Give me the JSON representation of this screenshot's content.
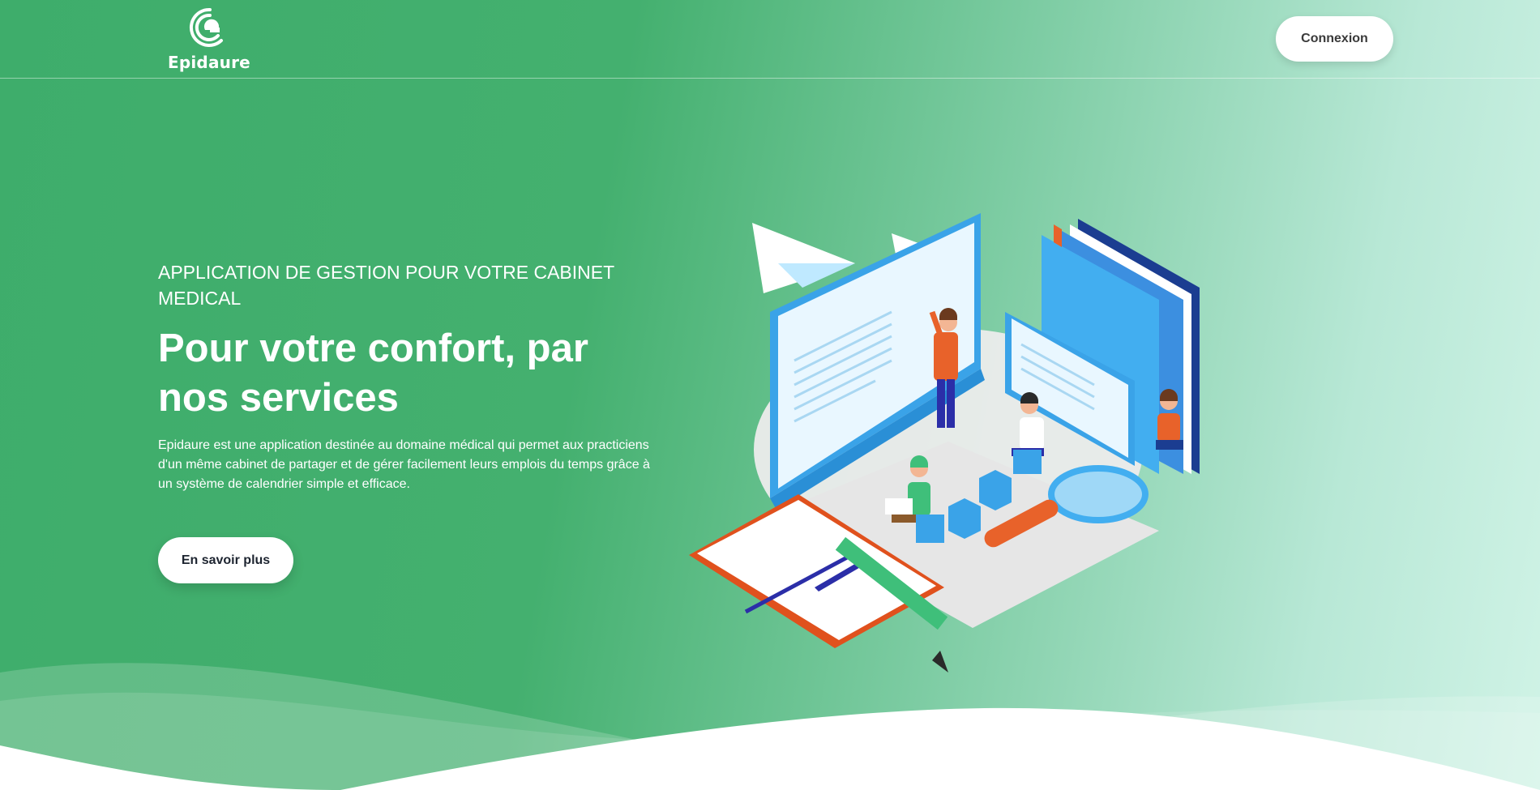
{
  "header": {
    "logo_text": "Epidaure",
    "login_label": "Connexion"
  },
  "hero": {
    "eyebrow": "APPLICATION DE GESTION POUR VOTRE CABINET MEDICAL",
    "title": "Pour votre confort, par nos services",
    "description": "Epidaure est une application destinée au domaine médical qui permet aux practiciens d'un même cabinet de partager et de gérer facilement leurs emplois du temps grâce à un système de calendrier simple et efficace.",
    "cta_label": "En savoir plus"
  },
  "icons": {
    "logo": "epidaure-logo-icon",
    "illustration": "team-working-isometric-illustration"
  },
  "colors": {
    "primary_green": "#3ead6b",
    "light_mint": "#d0f3e6",
    "button_white": "#ffffff",
    "button_text": "#3a3a3a"
  }
}
